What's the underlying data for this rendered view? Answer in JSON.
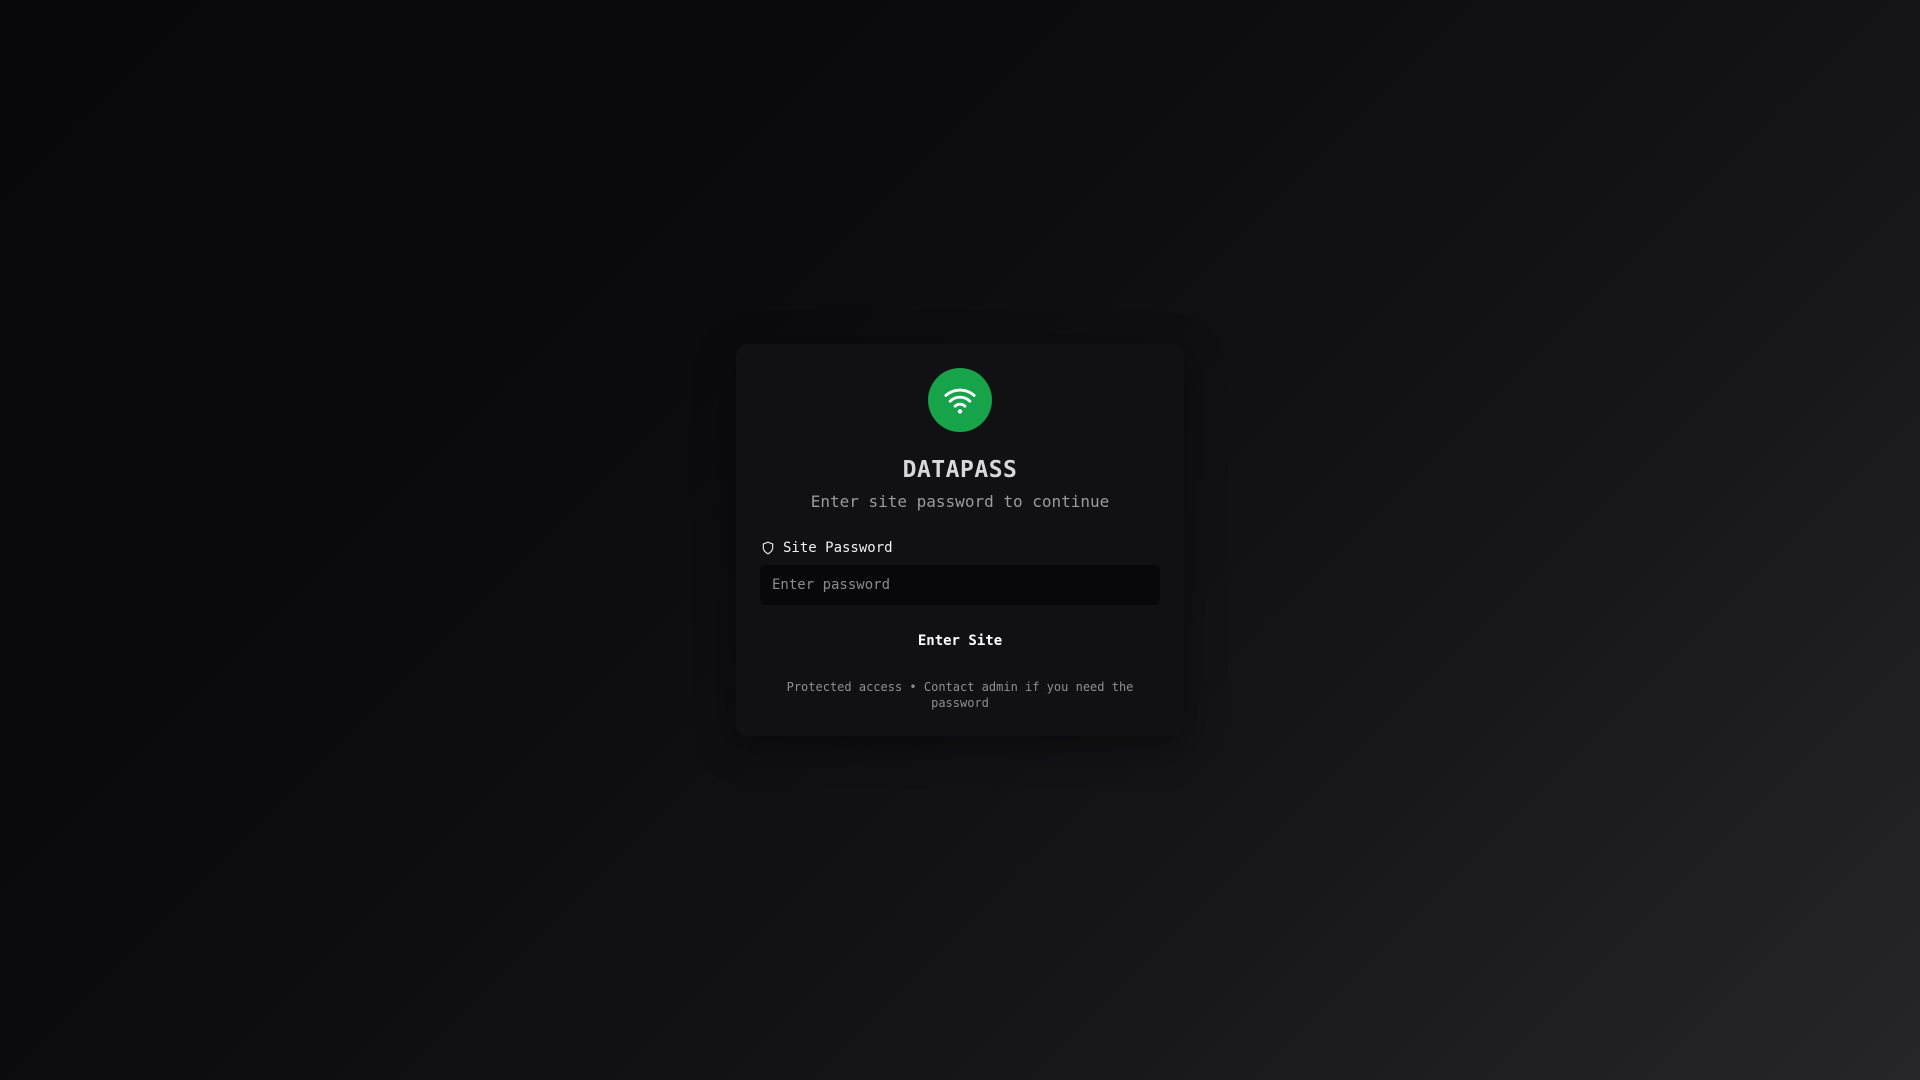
{
  "colors": {
    "accent": "#16a34a",
    "background": "#0b0b0d",
    "card": "#111114"
  },
  "card": {
    "logo_icon": "wifi-icon",
    "title": "DATAPASS",
    "subtitle": "Enter site password to continue"
  },
  "form": {
    "label_icon": "shield-icon",
    "label": "Site Password",
    "password_placeholder": "Enter password",
    "password_value": "",
    "submit_label": "Enter Site"
  },
  "footer": {
    "note": "Protected access • Contact admin if you need the password"
  }
}
